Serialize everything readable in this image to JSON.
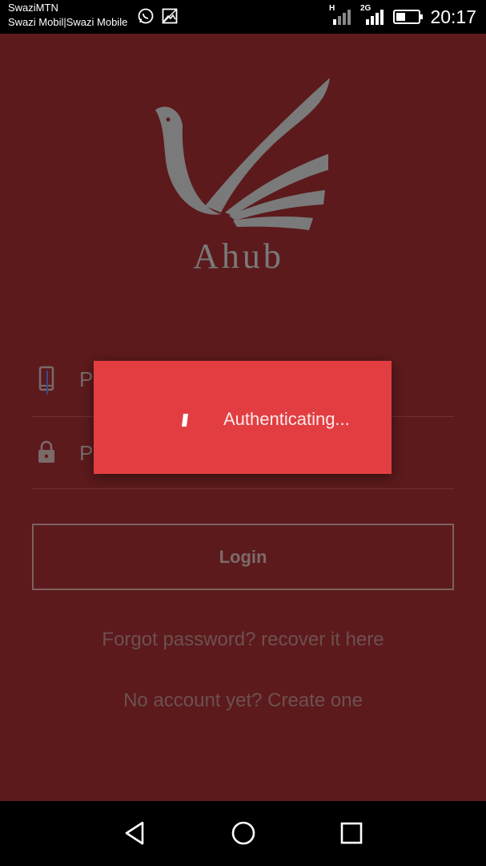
{
  "status_bar": {
    "carrier_primary": "SwaziMTN",
    "carrier_secondary": "Swazi Mobil|Swazi Mobile",
    "network_1": "H",
    "network_2": "2G",
    "time": "20:17",
    "icons": [
      "whatsapp-icon",
      "image-icon",
      "signal-icon",
      "signal-icon",
      "battery-icon"
    ]
  },
  "app": {
    "logo_text": "Ahub",
    "phone_field": {
      "placeholder": "P",
      "icon": "phone-icon"
    },
    "password_field": {
      "placeholder": "P",
      "icon": "lock-icon"
    },
    "login_label": "Login",
    "forgot_link": "Forgot password? recover it here",
    "signup_link": "No account yet? Create one"
  },
  "dialog": {
    "message": "Authenticating...",
    "icon": "spinner-icon"
  },
  "nav_bar": {
    "items": [
      "back-icon",
      "home-icon",
      "recents-icon"
    ]
  },
  "colors": {
    "background": "#5c1a1c",
    "dialog": "#e23e42",
    "logo": "#7a7a7a"
  }
}
